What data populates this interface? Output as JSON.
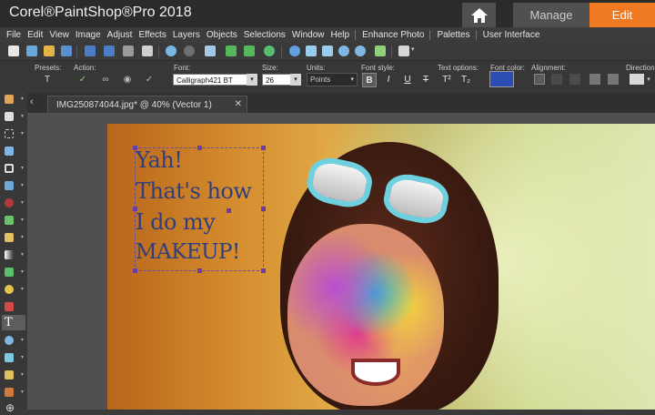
{
  "app": {
    "title": "Corel®PaintShop®Pro 2018",
    "workspace_tabs": [
      {
        "label": "Manage"
      },
      {
        "label": "Edit"
      }
    ],
    "accent_color": "#f07a24"
  },
  "menu": {
    "items": [
      "File",
      "Edit",
      "View",
      "Image",
      "Adjust",
      "Effects",
      "Layers",
      "Objects",
      "Selections",
      "Window",
      "Help",
      "Enhance Photo",
      "Palettes",
      "User Interface"
    ]
  },
  "options": {
    "presets_label": "Presets:",
    "action_label": "Action:",
    "font_label": "Font:",
    "font_value": "Calligraph421 BT",
    "size_label": "Size:",
    "size_value": "26",
    "units_label": "Units:",
    "units_value": "Points",
    "font_style_label": "Font style:",
    "text_options_label": "Text options:",
    "font_color_label": "Font color:",
    "font_color": "#2c4db3",
    "alignment_label": "Alignment:",
    "direction_label": "Direction:"
  },
  "document": {
    "tab_label": "IMG250874044.jpg* @  40% (Vector 1)",
    "text_lines": [
      "Yah!",
      "That's how",
      "I do my",
      "MAKEUP!"
    ],
    "text_color": "#2f3f7d"
  }
}
